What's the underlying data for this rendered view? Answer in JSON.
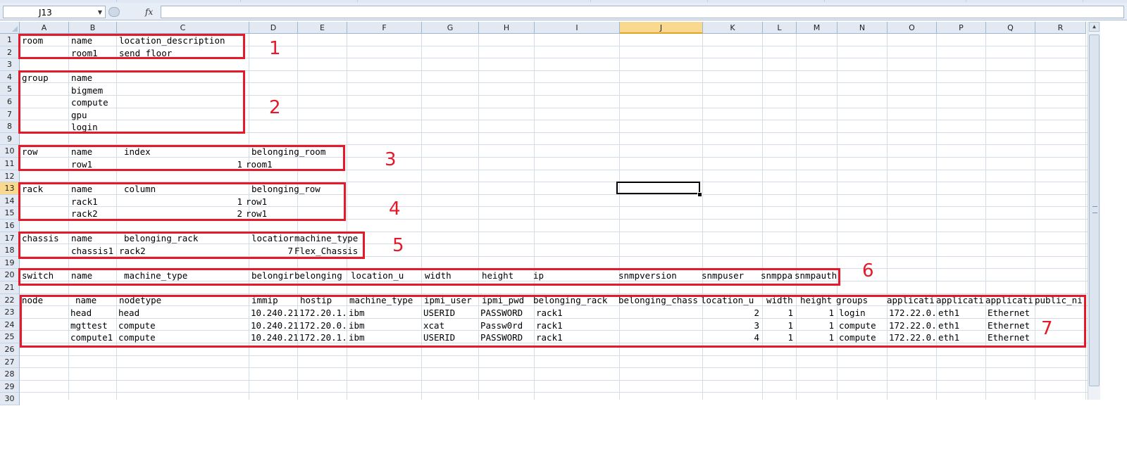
{
  "formula_bar": {
    "name_box": "J13",
    "fx_label": "fx",
    "formula": ""
  },
  "columns": [
    "A",
    "B",
    "C",
    "D",
    "E",
    "F",
    "G",
    "H",
    "I",
    "J",
    "K",
    "L",
    "M",
    "N",
    "O",
    "P",
    "Q",
    "R"
  ],
  "selected_column": "J",
  "rows": [
    "1",
    "2",
    "3",
    "4",
    "5",
    "6",
    "7",
    "8",
    "9",
    "10",
    "11",
    "12",
    "13",
    "14",
    "15",
    "16",
    "17",
    "18",
    "19",
    "20",
    "21",
    "22",
    "23",
    "24",
    "25",
    "26",
    "27",
    "28",
    "29",
    "30"
  ],
  "selected_row": "13",
  "sheet": {
    "r1": [
      "room",
      "name",
      "location_description"
    ],
    "r2": [
      "room1",
      "send floor"
    ],
    "r4": [
      "group",
      "name"
    ],
    "r5": "bigmem",
    "r6": "compute",
    "r7": "gpu",
    "r8": "login",
    "r10": [
      "row",
      "name",
      "index",
      "belonging_room"
    ],
    "r11": [
      "row1",
      "1",
      "room1"
    ],
    "r13": [
      "rack",
      "name",
      "column",
      "belonging_row"
    ],
    "r14": [
      "rack1",
      "1",
      "row1"
    ],
    "r15": [
      "rack2",
      "2",
      "row1"
    ],
    "r17": [
      "chassis",
      "name",
      "belonging_rack",
      "locatior",
      "machine_type"
    ],
    "r18": [
      "chassis1",
      "rack2",
      "7",
      "Flex_Chassis"
    ],
    "r20": [
      "switch",
      "name",
      "machine_type",
      "belongir",
      "belonging",
      "location_u",
      "width",
      "height",
      "ip",
      "snmpversion",
      "snmpuser",
      "snmppa",
      "snmpauth"
    ],
    "r22": [
      "node",
      "name",
      "nodetype",
      "immip",
      "hostip",
      "machine_type",
      "ipmi_user",
      "ipmi_pwd",
      "belonging_rack",
      "belonging_chass",
      "location_u",
      "width",
      "height",
      "groups",
      "applicati",
      "applicati",
      "applicati",
      "public_ni"
    ],
    "r23": [
      "head",
      "head",
      "10.240.21",
      "172.20.1.",
      "ibm",
      "USERID",
      "PASSWORD",
      "rack1",
      "2",
      "1",
      "1",
      "login",
      "172.22.0.",
      "eth1",
      "Ethernet"
    ],
    "r24": [
      "mgttest",
      "compute",
      "10.240.21",
      "172.20.0.",
      "ibm",
      "xcat",
      "Passw0rd",
      "rack1",
      "3",
      "1",
      "1",
      "compute",
      "172.22.0.",
      "eth1",
      "Ethernet"
    ],
    "r25": [
      "compute1",
      "compute",
      "10.240.21",
      "172.20.1.",
      "ibm",
      "USERID",
      "PASSWORD",
      "rack1",
      "4",
      "1",
      "1",
      "compute",
      "172.22.0.",
      "eth1",
      "Ethernet"
    ]
  },
  "annotations": [
    "1",
    "2",
    "3",
    "4",
    "5",
    "6",
    "7"
  ],
  "colors": {
    "annotation_red": "#e41a2a",
    "selected_header": "#f8d98e",
    "header_bg": "#e3e9f2"
  }
}
